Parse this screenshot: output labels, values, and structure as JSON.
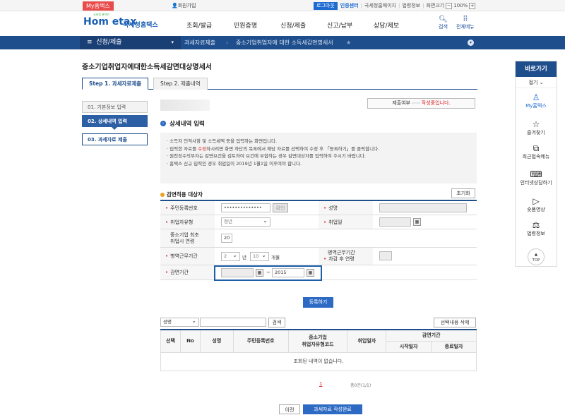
{
  "topbar": {
    "my_tab": "My홈택스",
    "join": "회원가입",
    "login": "로그아웃",
    "cert": "인증센터",
    "links": [
      "국세청홈페이지",
      "법령정보"
    ],
    "zoom_label": "화면크기",
    "zoom_value": "100%",
    "zoom_minus": "−",
    "zoom_plus": "+"
  },
  "header": {
    "logo_text": "Hom etax",
    "logo_small": "국세청 홈택스",
    "logo_suffix": "국세청홈택스",
    "menu": [
      "조회/발급",
      "민원증명",
      "신청/제출",
      "신고/납부",
      "상담/제보"
    ],
    "search_label": "검색",
    "allmenu_label": "전체메뉴"
  },
  "nav": {
    "current": "신청/제출",
    "crumbs": [
      "과세자료제출",
      "중소기업취업자에 대한 소득세감면명세서"
    ]
  },
  "page": {
    "title": "중소기업취업자에대한소득세감면대상명세서"
  },
  "tabs": [
    "Step 1. 과세자료제출",
    "Step 2. 제출내역"
  ],
  "steps": [
    "01. 기본정보 입력",
    "02. 상세내역 입력",
    "03. 과세자료 제출"
  ],
  "status": {
    "label": "제출여부",
    "arrows": "››››",
    "value": "작성중입니다."
  },
  "section": {
    "title": "상세내역 입력"
  },
  "notice": {
    "line1": "소득자 인적사항 및 소득세액 등을 입력하는 화면입니다.",
    "line2_a": "입력한 자료를 ",
    "line2_red": "수정",
    "line2_b": "하시려면 화면 하단의 목록에서 해당 자료를 선택하여 수정 후 「등록하기」를 클릭합니다.",
    "line3": "원천징수의무자는 감면요건을 검토하여 요건에 부합하는 경우 감면대상자를 입력하여 주시기 바랍니다.",
    "line4": "홈택스 신규 입력인 경우 취업일이 2019년 1월1일 이후여야 합니다."
  },
  "form": {
    "heading": "감면적용 대상자",
    "reset": "초기화",
    "rrn_label": "주민등록번호",
    "rrn_value": "••••••••••••••",
    "confirm": "확인",
    "name_label": "성명",
    "type_label": "취업자유형",
    "type_value": "청년",
    "hire_label": "취업일",
    "age_label_1": "중소기업 최초",
    "age_label_2": "취업시 연령",
    "age_value": "20",
    "mil_label": "병역근무기간",
    "mil_year": "2",
    "year_unit": "년",
    "mil_month": "10",
    "month_unit": "개월",
    "mil_age_label_1": "병역근무기간",
    "mil_age_label_2": "차감 후 연령",
    "period_label": "감면기간",
    "period_end": "2015",
    "tilde": "~"
  },
  "register": "등록하기",
  "list": {
    "filter_value": "성명",
    "search": "검색",
    "delete_selected": "선택내용 삭제",
    "headers": {
      "select": "선택",
      "no": "No",
      "name": "성명",
      "rrn": "주민등록번호",
      "type_1": "중소기업",
      "type_2": "취업자유형코드",
      "hire": "취업일자",
      "period": "감면기간",
      "start": "시작일자",
      "end": "종료일자"
    },
    "empty": "조회된 내역이 없습니다.",
    "page": "1",
    "count": "총0건(1/1)"
  },
  "buttons": {
    "prev": "이전",
    "next": "과세자료 작성완료"
  },
  "sidebar": {
    "title": "바로가기",
    "fold": "접기 ⌄",
    "items": [
      "My홈택스",
      "즐겨찾기",
      "최근접속메뉴",
      "인터넷상담하기",
      "숏폼영상",
      "법령정보"
    ],
    "top": "TOP"
  },
  "colors": {
    "navy": "#1f4e8c",
    "blue": "#2d6ac4",
    "red": "#d22222"
  }
}
